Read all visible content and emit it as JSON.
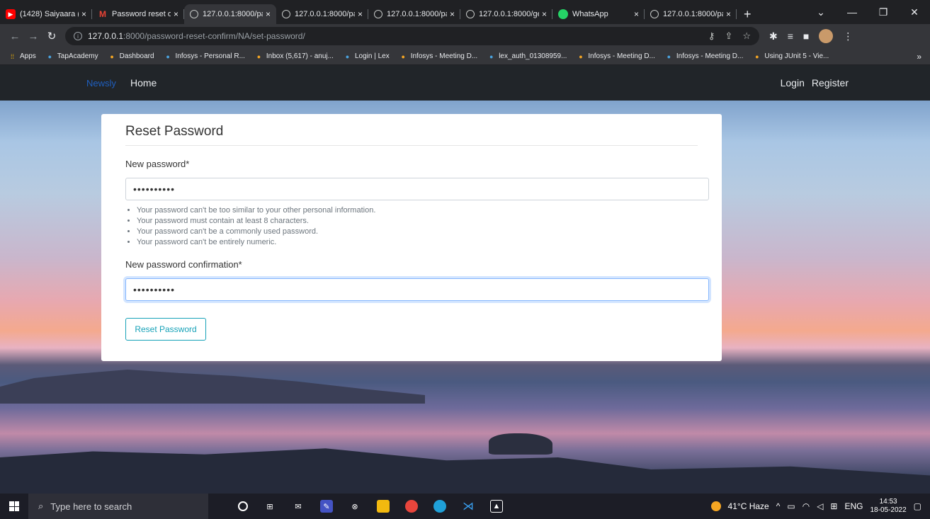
{
  "browser": {
    "tabs": [
      {
        "title": "(1428) Saiyaara (",
        "favicon": "youtube-icon",
        "active": false
      },
      {
        "title": "Password reset or",
        "favicon": "gmail-icon",
        "active": false
      },
      {
        "title": "127.0.0.1:8000/pa",
        "favicon": "globe-icon",
        "active": true
      },
      {
        "title": "127.0.0.1:8000/pa",
        "favicon": "globe-icon",
        "active": false
      },
      {
        "title": "127.0.0.1:8000/pa",
        "favicon": "globe-icon",
        "active": false
      },
      {
        "title": "127.0.0.1:8000/ge",
        "favicon": "globe-icon",
        "active": false
      },
      {
        "title": "WhatsApp",
        "favicon": "whatsapp-icon",
        "active": false
      },
      {
        "title": "127.0.0.1:8000/pa",
        "favicon": "globe-icon",
        "active": false
      }
    ],
    "close_glyph": "×",
    "new_tab_glyph": "+",
    "url_host": "127.0.0.1",
    "url_path": ":8000/password-reset-confirm/NA/set-password/",
    "bookmarks": [
      "Apps",
      "TapAcademy",
      "Dashboard",
      "Infosys - Personal R...",
      "Inbox (5,617) - anuj...",
      "Login | Lex",
      "Infosys - Meeting D...",
      "lex_auth_01308959...",
      "Infosys - Meeting D...",
      "Infosys - Meeting D...",
      "Using JUnit 5 - Vie..."
    ],
    "bookmarks_more": "»"
  },
  "navbar": {
    "brand": "Newsly",
    "home": "Home",
    "login": "Login",
    "register": "Register"
  },
  "form": {
    "title": "Reset Password",
    "new_password_label": "New password*",
    "new_password_value": "••••••••••",
    "help_items": [
      "Your password can't be too similar to your other personal information.",
      "Your password must contain at least 8 characters.",
      "Your password can't be a commonly used password.",
      "Your password can't be entirely numeric."
    ],
    "confirm_label": "New password confirmation*",
    "confirm_value": "••••••••••",
    "submit_label": "Reset Password"
  },
  "taskbar": {
    "search_placeholder": "Type here to search",
    "weather": "41°C Haze",
    "lang": "ENG",
    "time": "14:53",
    "date": "18-05-2022"
  },
  "colors": {
    "brand": "#1f5fbf",
    "button_outline": "#17a2b8",
    "navbar_bg": "#212529"
  }
}
